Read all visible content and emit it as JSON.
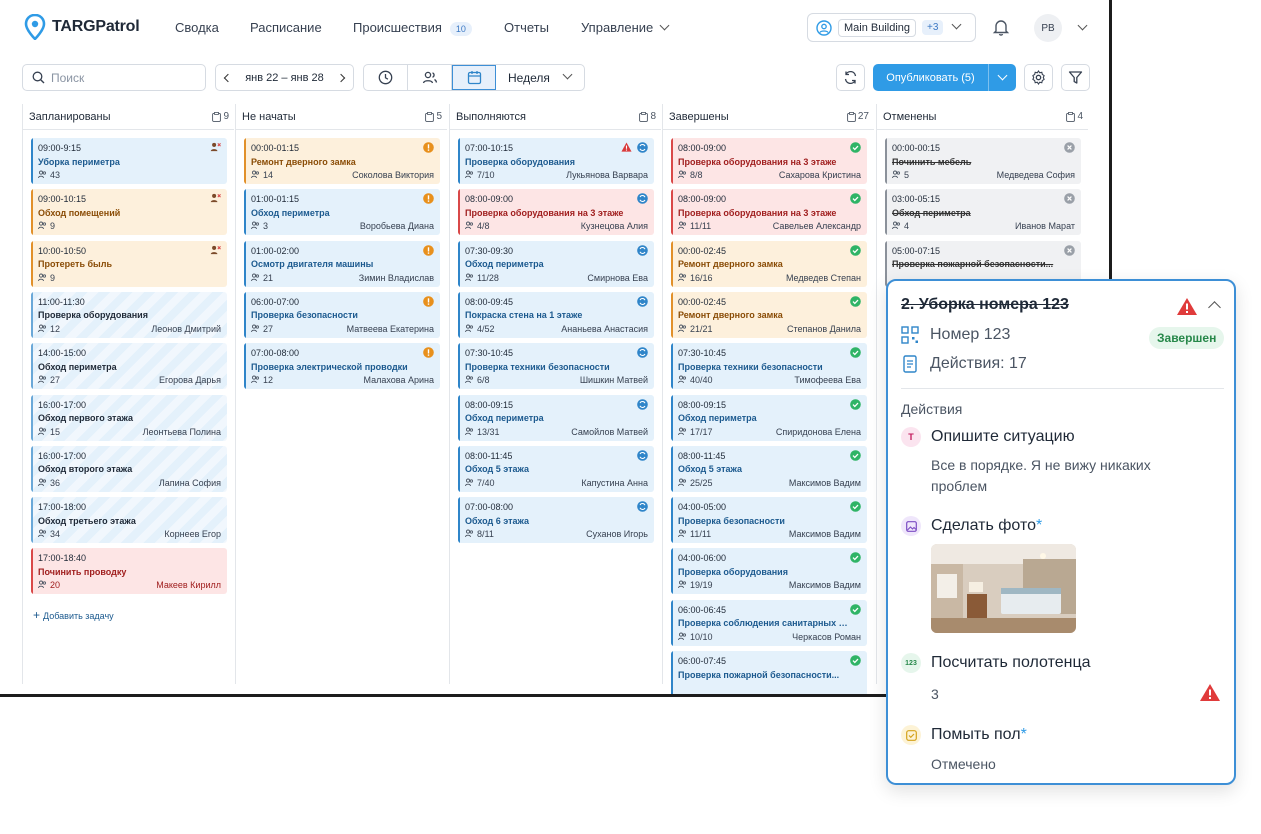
{
  "app": {
    "brand": "TARGPatrol"
  },
  "nav": {
    "items": [
      "Сводка",
      "Расписание",
      "Происшествия",
      "Отчеты",
      "Управление"
    ],
    "incidents_badge": "10",
    "building": "Main Building",
    "building_extra": "+3",
    "avatar_initials": "PB"
  },
  "toolbar": {
    "search_placeholder": "Поиск",
    "date_range": "янв 22 – янв 28",
    "view_mode": "Неделя",
    "publish_label": "Опубликовать (5)"
  },
  "columns": [
    {
      "title": "Запланированы",
      "count": "9",
      "add_task": "Добавить задачу",
      "cards": [
        {
          "style": "blue",
          "time": "09:00-9:15",
          "title": "Уборка периметра",
          "meta": "43",
          "person": "",
          "icon": "unassigned-person-icon"
        },
        {
          "style": "orange",
          "time": "09:00-10:15",
          "title": "Обход помещений",
          "meta": "9",
          "person": "",
          "icon": "unassigned-person-icon"
        },
        {
          "style": "orange",
          "time": "10:00-10:50",
          "title": "Протереть быль",
          "meta": "9",
          "person": "",
          "icon": "unassigned-person-icon"
        },
        {
          "style": "stripe",
          "time": "11:00-11:30",
          "title": "Проверка оборудования",
          "meta": "12",
          "person": "Леонов Дмитрий",
          "icon": ""
        },
        {
          "style": "stripe",
          "time": "14:00-15:00",
          "title": "Обход периметра",
          "meta": "27",
          "person": "Егорова Дарья",
          "icon": ""
        },
        {
          "style": "stripe",
          "time": "16:00-17:00",
          "title": "Обход первого этажа",
          "meta": "15",
          "person": "Леонтьева Полина",
          "icon": ""
        },
        {
          "style": "stripe",
          "time": "16:00-17:00",
          "title": "Обход второго этажа",
          "meta": "36",
          "person": "Лапина София",
          "icon": ""
        },
        {
          "style": "stripe",
          "time": "17:00-18:00",
          "title": "Обход третьего этажа",
          "meta": "34",
          "person": "Корнеев Егор",
          "icon": ""
        },
        {
          "style": "red",
          "time": "17:00-18:40",
          "title": "Починить проводку",
          "meta": "20",
          "person": "Макеев Кирилл",
          "icon": ""
        }
      ]
    },
    {
      "title": "Не начаты",
      "count": "5",
      "cards": [
        {
          "style": "orange",
          "time": "00:00-01:15",
          "title": "Ремонт дверного замка",
          "meta": "14",
          "person": "Соколова Виктория",
          "icon": "warning-orange-icon"
        },
        {
          "style": "blue",
          "time": "01:00-01:15",
          "title": "Обход периметра",
          "meta": "3",
          "person": "Воробьева Диана",
          "icon": "warning-orange-icon"
        },
        {
          "style": "blue",
          "time": "01:00-02:00",
          "title": "Осмотр двигателя машины",
          "meta": "21",
          "person": "Зимин Владислав",
          "icon": "warning-orange-icon"
        },
        {
          "style": "blue",
          "time": "06:00-07:00",
          "title": "Проверка безопасности",
          "meta": "27",
          "person": "Матвеева Екатерина",
          "icon": "warning-orange-icon"
        },
        {
          "style": "blue",
          "time": "07:00-08:00",
          "title": "Проверка электрической проводки",
          "meta": "12",
          "person": "Малахова Арина",
          "icon": "warning-orange-icon"
        }
      ]
    },
    {
      "title": "Выполняются",
      "count": "8",
      "cards": [
        {
          "style": "blue",
          "time": "07:00-10:15",
          "title": "Проверка оборудования",
          "meta": "7/10",
          "person": "Лукьянова Варвара",
          "icon": "in-progress-icon",
          "alert": true
        },
        {
          "style": "red",
          "time": "08:00-09:00",
          "title": "Проверка оборудования на 3 этаже",
          "meta": "4/8",
          "person": "Кузнецова Алия",
          "icon": "in-progress-icon"
        },
        {
          "style": "blue",
          "time": "07:30-09:30",
          "title": "Обход периметра",
          "meta": "11/28",
          "person": "Смирнова Ева",
          "icon": "in-progress-icon"
        },
        {
          "style": "blue",
          "time": "08:00-09:45",
          "title": "Покраска стена на 1 этаже",
          "meta": "4/52",
          "person": "Ананьева Анастасия",
          "icon": "in-progress-icon"
        },
        {
          "style": "blue",
          "time": "07:30-10:45",
          "title": "Проверка техники безопасности",
          "meta": "6/8",
          "person": "Шишкин Матвей",
          "icon": "in-progress-icon"
        },
        {
          "style": "blue",
          "time": "08:00-09:15",
          "title": "Обход периметра",
          "meta": "13/31",
          "person": "Самойлов Матвей",
          "icon": "in-progress-icon"
        },
        {
          "style": "blue",
          "time": "08:00-11:45",
          "title": "Обход 5 этажа",
          "meta": "7/40",
          "person": "Капустина Анна",
          "icon": "in-progress-icon"
        },
        {
          "style": "blue",
          "time": "07:00-08:00",
          "title": "Обход 6 этажа",
          "meta": "8/11",
          "person": "Суханов Игорь",
          "icon": "in-progress-icon"
        }
      ]
    },
    {
      "title": "Завершены",
      "count": "27",
      "cards": [
        {
          "style": "red",
          "time": "08:00-09:00",
          "title": "Проверка оборудования на 3 этаже",
          "meta": "8/8",
          "person": "Сахарова Кристина",
          "icon": "check-icon"
        },
        {
          "style": "red",
          "time": "08:00-09:00",
          "title": "Проверка оборудования на 3 этаже",
          "meta": "11/11",
          "person": "Савельев Александр",
          "icon": "check-icon"
        },
        {
          "style": "orange",
          "time": "00:00-02:45",
          "title": "Ремонт дверного замка",
          "meta": "16/16",
          "person": "Медведев Степан",
          "icon": "check-icon"
        },
        {
          "style": "orange",
          "time": "00:00-02:45",
          "title": "Ремонт дверного замка",
          "meta": "21/21",
          "person": "Степанов Данила",
          "icon": "check-icon"
        },
        {
          "style": "blue",
          "time": "07:30-10:45",
          "title": "Проверка техники безопасности",
          "meta": "40/40",
          "person": "Тимофеева Ева",
          "icon": "check-icon"
        },
        {
          "style": "blue",
          "time": "08:00-09:15",
          "title": "Обход периметра",
          "meta": "17/17",
          "person": "Спиридонова Елена",
          "icon": "check-icon"
        },
        {
          "style": "blue",
          "time": "08:00-11:45",
          "title": "Обход 5 этажа",
          "meta": "25/25",
          "person": "Максимов Вадим",
          "icon": "check-icon"
        },
        {
          "style": "blue",
          "time": "04:00-05:00",
          "title": "Проверка безопасности",
          "meta": "11/11",
          "person": "Максимов Вадим",
          "icon": "check-icon"
        },
        {
          "style": "blue",
          "time": "04:00-06:00",
          "title": "Проверка оборудования",
          "meta": "19/19",
          "person": "Максимов Вадим",
          "icon": "check-icon"
        },
        {
          "style": "blue",
          "time": "06:00-06:45",
          "title": "Проверка соблюдения санитарных но...",
          "meta": "10/10",
          "person": "Черкасов Роман",
          "icon": "check-icon"
        },
        {
          "style": "blue",
          "time": "06:00-07:45",
          "title": "Проверка пожарной безопасности...",
          "meta": "",
          "person": "",
          "icon": "check-icon"
        }
      ]
    },
    {
      "title": "Отменены",
      "count": "4",
      "cards": [
        {
          "style": "grey",
          "time": "00:00-00:15",
          "title": "Починить мебель",
          "meta": "5",
          "person": "Медведева София",
          "icon": "cancel-icon"
        },
        {
          "style": "grey",
          "time": "03:00-05:15",
          "title": "Обход периметра",
          "meta": "4",
          "person": "Иванов Марат",
          "icon": "cancel-icon"
        },
        {
          "style": "grey",
          "time": "05:00-07:15",
          "title": "Проверка пожарной безопасности...",
          "meta": "",
          "person": "",
          "icon": "cancel-icon"
        }
      ]
    }
  ],
  "popup": {
    "title": "2. Уборка номера 123",
    "room": "Номер 123",
    "status": "Завершен",
    "actions_count": "Действия: 17",
    "section_label": "Действия",
    "actions": [
      {
        "badge": "T",
        "label": "Опишите ситуацию",
        "required": "",
        "value": "Все в порядке. Я не вижу никаких проблем"
      },
      {
        "badge": "photo",
        "label": "Сделать фото",
        "required": "*",
        "value": ""
      },
      {
        "badge": "123",
        "label": "Посчитать полотенца",
        "required": "",
        "value": "3"
      },
      {
        "badge": "check",
        "label": "Помыть пол",
        "required": "*",
        "value": "Отмечено"
      }
    ]
  },
  "colors": {
    "accent": "#2f9be6",
    "blue": "#2f85c9",
    "orange": "#e1902a",
    "red": "#d94848",
    "green": "#2fb466",
    "grey": "#8b919a"
  }
}
